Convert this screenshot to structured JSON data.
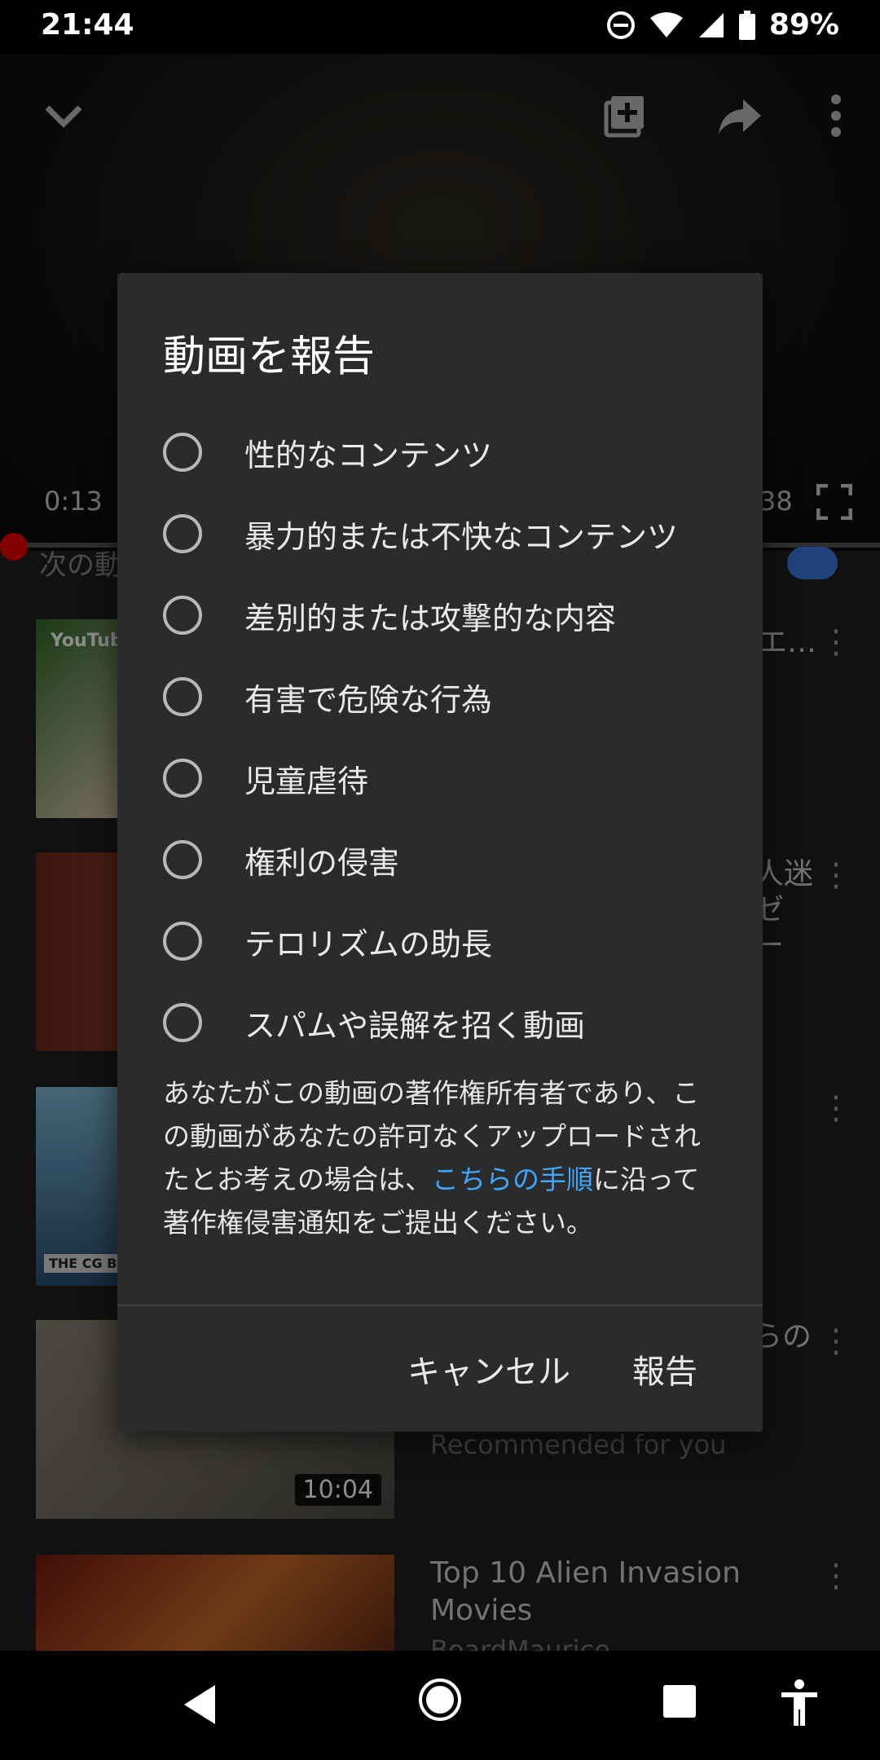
{
  "status": {
    "time": "21:44",
    "battery": "89%"
  },
  "player": {
    "current_time": "0:13",
    "end_time_fragment": "38"
  },
  "feed": {
    "next_up_fragment": "次の動",
    "items": [
      {
        "thumb_text": "YouTube Ori",
        "title_fragment": "エ…"
      },
      {
        "title_fragment": "人迷\nゼ\nー"
      },
      {
        "thumb_text": "THE CG BROS"
      },
      {
        "title_fragment": "らの",
        "subtitle": "Recommended for you",
        "duration": "10:04"
      },
      {
        "title": "Top 10 Alien Invasion Movies",
        "subtitle_fragment": "BoardMaurice"
      }
    ]
  },
  "dialog": {
    "title": "動画を報告",
    "options": [
      "性的なコンテンツ",
      "暴力的または不快なコンテンツ",
      "差別的または攻撃的な内容",
      "有害で危険な行為",
      "児童虐待",
      "権利の侵害",
      "テロリズムの助長",
      "スパムや誤解を招く動画"
    ],
    "notice_prefix": "あなたがこの動画の著作権所有者であり、この動画があなたの許可なくアップロードされたとお考えの場合は、",
    "notice_link": "こちらの手順",
    "notice_suffix": "に沿って著作権侵害通知をご提出ください。",
    "cancel_label": "キャンセル",
    "report_label": "報告"
  }
}
